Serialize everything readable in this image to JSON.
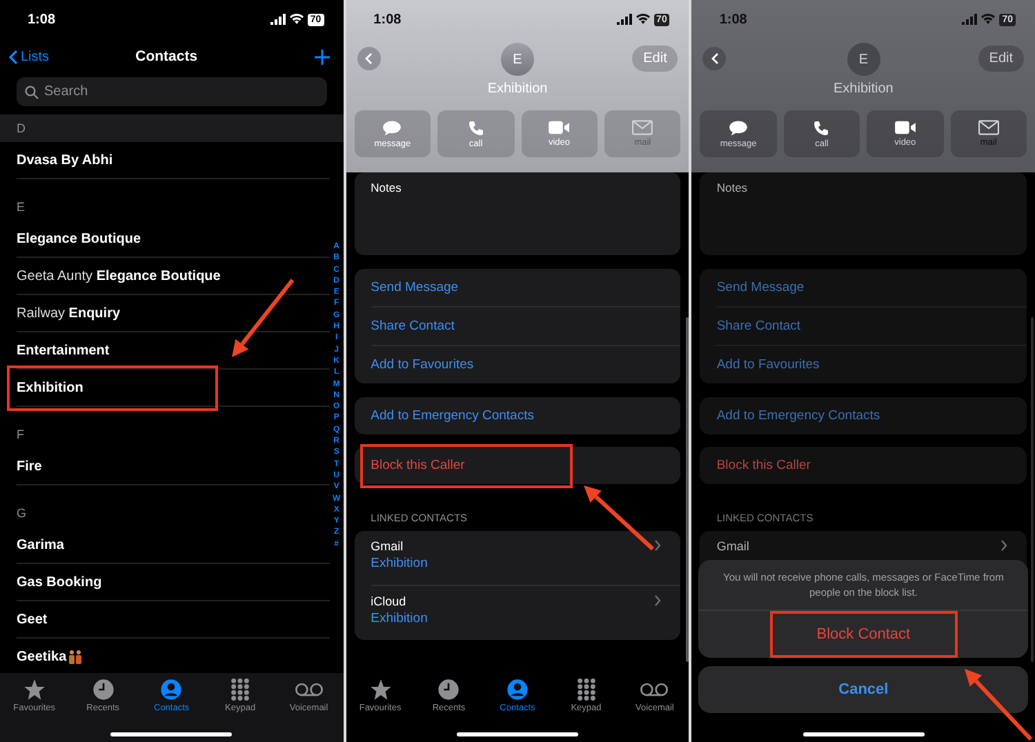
{
  "screens": [
    {
      "kind": "contacts",
      "status_bar": {
        "time": "1:08",
        "battery": "70"
      },
      "nav": {
        "back": "Lists",
        "title": "Contacts"
      },
      "search": {
        "placeholder": "Search"
      },
      "sections": [
        {
          "letter": "D",
          "rows": [
            {
              "name": "Dvasa By Abhi",
              "emoji": false,
              "highlighted": false
            }
          ]
        },
        {
          "letter": "E",
          "rows": [
            {
              "name": "Elegance Boutique",
              "emoji": false,
              "highlighted": false
            },
            {
              "prefix": "Geeta Aunty",
              "name": "Elegance Boutique",
              "emoji": false,
              "highlighted": false
            },
            {
              "prefix": "Railway",
              "name": "Enquiry",
              "emoji": false,
              "highlighted": false
            },
            {
              "name": "Entertainment",
              "emoji": false,
              "highlighted": false
            },
            {
              "name": "Exhibition",
              "emoji": false,
              "highlighted": true
            }
          ]
        },
        {
          "letter": "F",
          "rows": [
            {
              "name": "Fire",
              "emoji": false,
              "highlighted": false
            }
          ]
        },
        {
          "letter": "G",
          "rows": [
            {
              "name": "Garima",
              "emoji": false,
              "highlighted": false
            },
            {
              "name": "Gas Booking",
              "emoji": false,
              "highlighted": false
            },
            {
              "name": "Geet",
              "emoji": false,
              "highlighted": false
            },
            {
              "name": "Geetika",
              "emoji": true,
              "highlighted": false
            }
          ]
        }
      ],
      "index": [
        "A",
        "B",
        "C",
        "D",
        "E",
        "F",
        "G",
        "H",
        "I",
        "J",
        "K",
        "L",
        "M",
        "N",
        "O",
        "P",
        "Q",
        "R",
        "S",
        "T",
        "U",
        "V",
        "W",
        "X",
        "Y",
        "Z",
        "#"
      ],
      "tab_bar": [
        {
          "kind": "star",
          "label": "Favourites",
          "selected": false
        },
        {
          "kind": "clock",
          "label": "Recents",
          "selected": false
        },
        {
          "kind": "person",
          "label": "Contacts",
          "selected": true
        },
        {
          "kind": "keypad",
          "label": "Keypad",
          "selected": false
        },
        {
          "kind": "voicemail",
          "label": "Voicemail",
          "selected": false
        }
      ]
    },
    {
      "kind": "detail",
      "dimmed": false,
      "status_bar": {
        "time": "1:08",
        "battery": "70"
      },
      "edit": "Edit",
      "avatar": "E",
      "name": "Exhibition",
      "actions": [
        {
          "kind": "message",
          "label": "message",
          "disabled": false
        },
        {
          "kind": "call",
          "label": "call",
          "disabled": false
        },
        {
          "kind": "video",
          "label": "video",
          "disabled": false
        },
        {
          "kind": "mail",
          "label": "mail",
          "disabled": true
        }
      ],
      "notes": "Notes",
      "options": [
        "Send Message",
        "Share Contact",
        "Add to Favourites"
      ],
      "emergency": "Add to Emergency Contacts",
      "block": {
        "label": "Block this Caller",
        "highlighted": true
      },
      "linked_header": "LINKED CONTACTS",
      "linked": [
        {
          "source": "Gmail",
          "name": "Exhibition"
        },
        {
          "source": "iCloud",
          "name": "Exhibition"
        }
      ],
      "tab_bar": [
        {
          "kind": "star",
          "label": "Favourites",
          "selected": false
        },
        {
          "kind": "clock",
          "label": "Recents",
          "selected": false
        },
        {
          "kind": "person",
          "label": "Contacts",
          "selected": true
        },
        {
          "kind": "keypad",
          "label": "Keypad",
          "selected": false
        },
        {
          "kind": "voicemail",
          "label": "Voicemail",
          "selected": false
        }
      ]
    },
    {
      "kind": "detail",
      "dimmed": true,
      "status_bar": {
        "time": "1:08",
        "battery": "70"
      },
      "edit": "Edit",
      "avatar": "E",
      "name": "Exhibition",
      "actions": [
        {
          "kind": "message",
          "label": "message",
          "disabled": false
        },
        {
          "kind": "call",
          "label": "call",
          "disabled": false
        },
        {
          "kind": "video",
          "label": "video",
          "disabled": false
        },
        {
          "kind": "mail",
          "label": "mail",
          "disabled": true
        }
      ],
      "notes": "Notes",
      "options": [
        "Send Message",
        "Share Contact",
        "Add to Favourites"
      ],
      "emergency": "Add to Emergency Contacts",
      "block": {
        "label": "Block this Caller",
        "highlighted": false
      },
      "linked_header": "LINKED CONTACTS",
      "linked": [
        {
          "source": "Gmail"
        }
      ],
      "sheet": {
        "message": "You will not receive phone calls, messages or FaceTime from people on the block list.",
        "confirm": {
          "label": "Block Contact",
          "highlighted": true
        },
        "cancel": "Cancel"
      }
    }
  ]
}
